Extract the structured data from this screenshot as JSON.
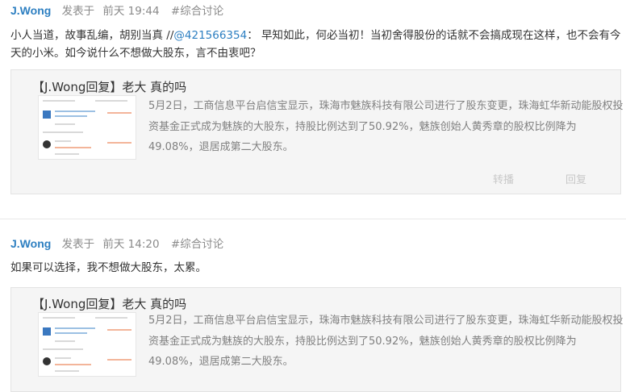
{
  "posts": [
    {
      "author": "J.Wong",
      "posted_label": "发表于",
      "time": "前天 19:44",
      "topic": "#综合讨论",
      "text_before": "小人当道，故事乱编，胡别当真 //",
      "mention": "@421566354",
      "text_after": "： 早知如此，何必当初！当初舍得股份的话就不会搞成现在这样，也不会有今天的小米。如今说什么不想做大股东，言不由衷吧？",
      "quote": {
        "title": "【J.Wong回复】老大 真的吗",
        "text": "5月2日，工商信息平台启信宝显示，珠海市魅族科技有限公司进行了股东变更，珠海虹华新动能股权投资基金正式成为魅族的大股东，持股比例达到了50.92%，魅族创始人黄秀章的股权比例降为49.08%，退居成第二大股东。",
        "repost_label": "转播",
        "reply_label": "回复"
      }
    },
    {
      "author": "J.Wong",
      "posted_label": "发表于",
      "time": "前天 14:20",
      "topic": "#综合讨论",
      "text": "如果可以选择，我不想做大股东，太累。",
      "quote": {
        "title": "【J.Wong回复】老大 真的吗",
        "text": "5月2日，工商信息平台启信宝显示，珠海市魅族科技有限公司进行了股东变更，珠海虹华新动能股权投资基金正式成为魅族的大股东，持股比例达到了50.92%，魅族创始人黄秀章的股权比例降为49.08%，退居成第二大股东。"
      }
    }
  ],
  "colors": {
    "author": "#2d7fc1",
    "meta": "#8a8a8a",
    "quote_bg": "#f5f5f5",
    "quote_text": "#808080"
  }
}
